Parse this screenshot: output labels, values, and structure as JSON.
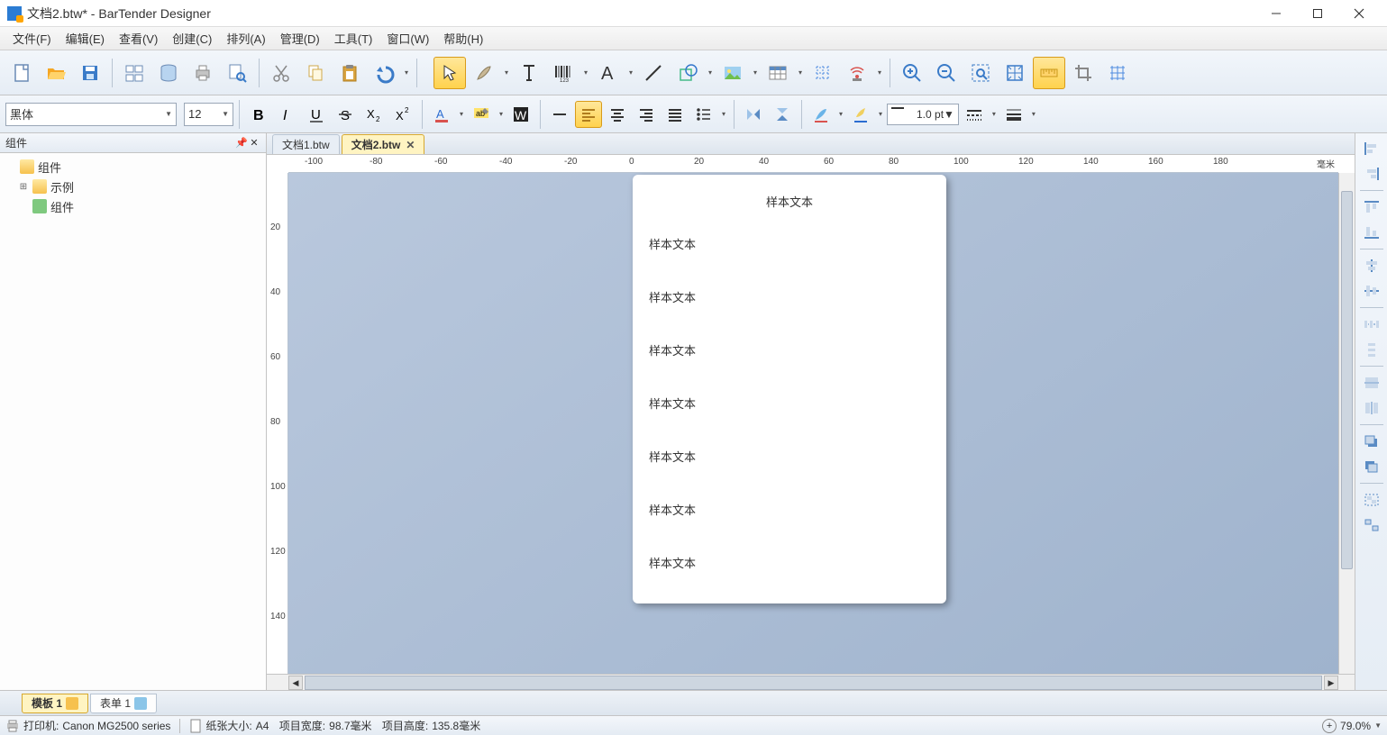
{
  "window": {
    "title": "文档2.btw* - BarTender Designer"
  },
  "menu": [
    "文件(F)",
    "编辑(E)",
    "查看(V)",
    "创建(C)",
    "排列(A)",
    "管理(D)",
    "工具(T)",
    "窗口(W)",
    "帮助(H)"
  ],
  "font": {
    "family": "黑体",
    "size": "12",
    "line_weight": "1.0 pt"
  },
  "side_panel": {
    "title": "组件",
    "root": "组件",
    "example": "示例",
    "comp": "组件"
  },
  "doc_tabs": [
    {
      "label": "文档1.btw",
      "active": false,
      "closable": false
    },
    {
      "label": "文档2.btw",
      "active": true,
      "closable": true
    }
  ],
  "ruler_h": {
    "ticks": [
      -100,
      -80,
      -60,
      -40,
      -20,
      0,
      20,
      40,
      60,
      80,
      100,
      120,
      140,
      160,
      180,
      20
    ],
    "unit": "毫米"
  },
  "ruler_v": {
    "ticks": [
      20,
      40,
      60,
      80,
      100,
      120,
      140
    ]
  },
  "canvas_text": {
    "title": "样本文本",
    "lines": [
      "样本文本",
      "样本文本",
      "样本文本",
      "样本文本",
      "样本文本",
      "样本文本",
      "样本文本"
    ]
  },
  "bottom_tabs": [
    {
      "label": "模板 1",
      "active": true
    },
    {
      "label": "表单 1",
      "active": false
    }
  ],
  "status": {
    "printer_label": "打印机:",
    "printer": "Canon MG2500 series",
    "paper_label": "纸张大小:",
    "paper": "A4",
    "width_label": "项目宽度:",
    "width": "98.7毫米",
    "height_label": "项目高度:",
    "height": "135.8毫米",
    "zoom": "79.0%"
  }
}
